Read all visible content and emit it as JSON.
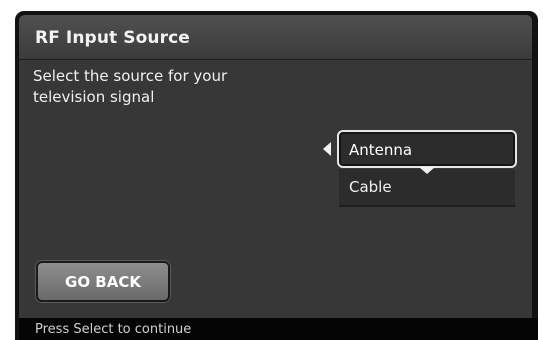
{
  "dialog": {
    "title": "RF Input Source",
    "instruction": "Select the source for your\ntelevision signal",
    "options": [
      {
        "label": "Antenna",
        "selected": true
      },
      {
        "label": "Cable",
        "selected": false
      }
    ],
    "go_back_label": "GO BACK",
    "status_text": "Press Select to continue"
  },
  "colors": {
    "frame": "#121212",
    "title_bar": "#444444",
    "content_bg": "#373737",
    "button": "#7c7c7c",
    "status_bar": "#050505"
  },
  "icons": {
    "left_arrow": "triangle-left-icon",
    "down_arrow": "triangle-down-icon"
  }
}
